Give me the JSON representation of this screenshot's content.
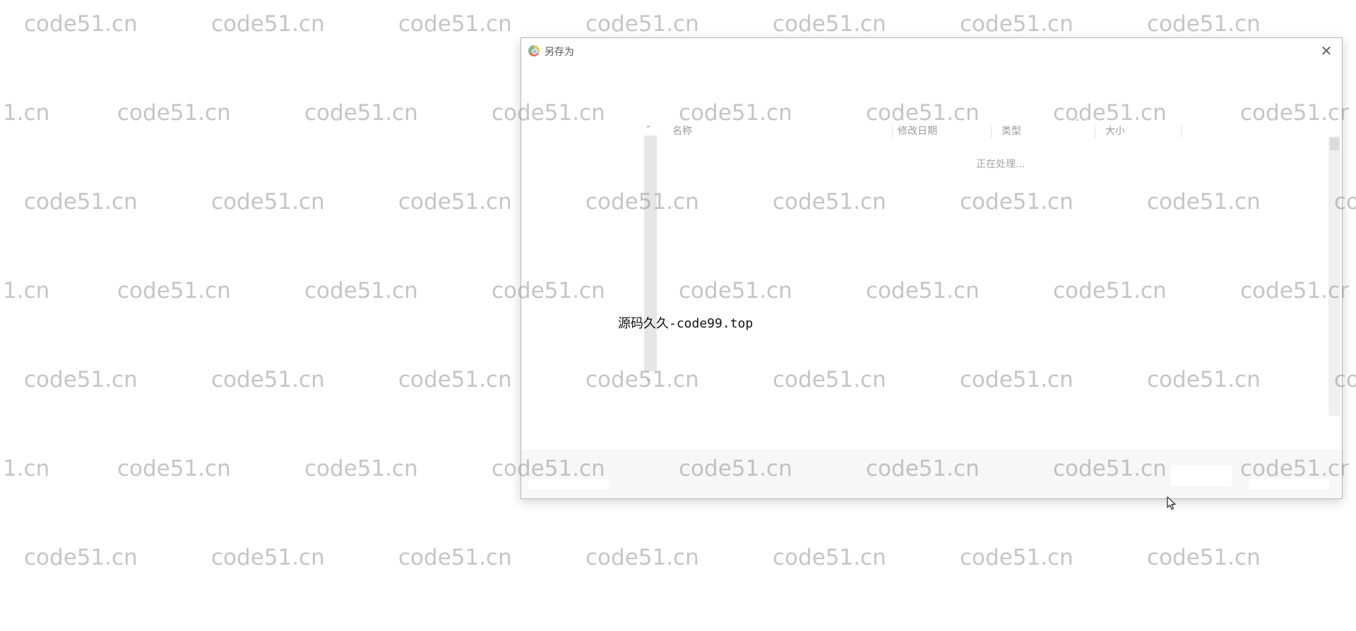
{
  "watermark": {
    "text_full": "code51.cn",
    "text_partial": "1.cn",
    "text_clipped_right": "co",
    "text_clipped_right_alt": "code51.cr"
  },
  "dialog": {
    "title": "另存为",
    "close_glyph": "✕",
    "columns": {
      "name": "名称",
      "modified": "修改日期",
      "type": "类型",
      "size": "大小"
    },
    "status_text": "正在处理...",
    "nav_scroll_up": "⌃",
    "nav_scroll_down": "⌄",
    "sort_glyph": "⌃"
  },
  "overlay_caption": "源码久久-code99.top",
  "icons": {
    "app": "chrome-icon",
    "close": "close-icon",
    "cursor": "mouse-pointer-icon"
  }
}
